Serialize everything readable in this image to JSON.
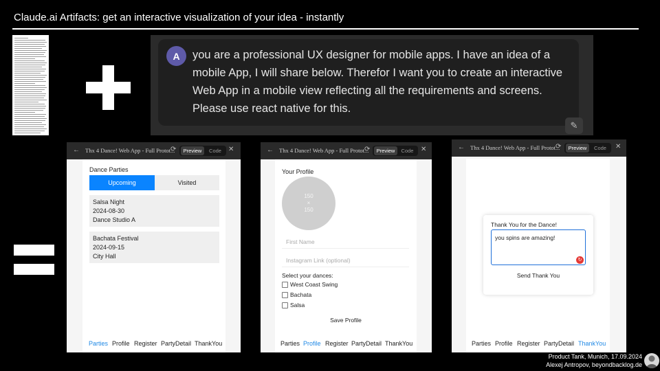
{
  "slide": {
    "title": "Claude.ai Artifacts: get an interactive visualization of your idea - instantly",
    "footer_line1": "Product Tank, Munich, 17.09.2024",
    "footer_line2": "Alexej Antropov, beyondbacklog.de"
  },
  "prompt": {
    "avatar_letter": "A",
    "text": "you are a professional UX designer for mobile apps. I have an idea of a mobile App, I will share below. Therefor I want you to create an interactive Web App in a mobile view reflecting all the requirements and screens. Please use react native for this.",
    "edit_icon": "pencil-icon"
  },
  "artifact": {
    "title": "Thx 4 Dance! Web App - Full Protot...",
    "preview_label": "Preview",
    "code_label": "Code"
  },
  "nav_items": [
    "Parties",
    "Profile",
    "Register",
    "PartyDetail",
    "ThankYou"
  ],
  "parties_screen": {
    "heading": "Dance Parties",
    "tabs": [
      "Upcoming",
      "Visited"
    ],
    "events": [
      {
        "name": "Salsa Night",
        "date": "2024-08-30",
        "place": "Dance Studio A"
      },
      {
        "name": "Bachata Festival",
        "date": "2024-09-15",
        "place": "City Hall"
      }
    ]
  },
  "profile_screen": {
    "heading": "Your Profile",
    "photo_w": "150",
    "photo_x": "×",
    "photo_h": "150",
    "first_name_placeholder": "First Name",
    "instagram_placeholder": "Instagram Link (optional)",
    "dances_label": "Select your dances:",
    "dances": [
      "West Coast Swing",
      "Bachata",
      "Salsa"
    ],
    "save_label": "Save Profile"
  },
  "thankyou_screen": {
    "heading": "Thank You for the Dance!",
    "message": "you spins are amazing!",
    "send_label": "Send Thank You"
  },
  "colors": {
    "accent": "#1e88e5",
    "tab_active": "#0a84ff"
  }
}
